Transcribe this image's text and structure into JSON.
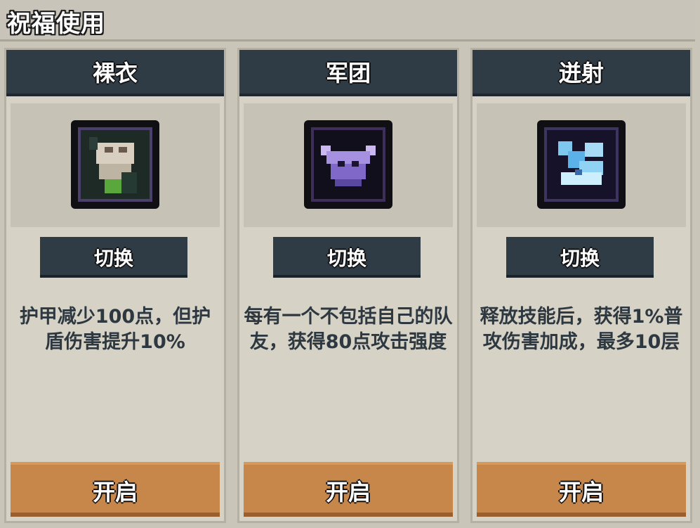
{
  "header": {
    "title": "祝福使用"
  },
  "cards": [
    {
      "title": "裸衣",
      "icon": "naked-robe-icon",
      "switch_label": "切换",
      "description": "护甲减少100点，但护盾伤害提升10%",
      "open_label": "开启"
    },
    {
      "title": "军团",
      "icon": "legion-helmet-icon",
      "switch_label": "切换",
      "description": "每有一个不包括自己的队友，获得80点攻击强度",
      "open_label": "开启"
    },
    {
      "title": "迸射",
      "icon": "burst-shard-icon",
      "switch_label": "切换",
      "description": "释放技能后，获得1%普攻伤害加成，最多10层",
      "open_label": "开启"
    }
  ],
  "colors": {
    "header_dark": "#2f3b45",
    "button_orange": "#c7864a",
    "card_bg": "#d6d2c6",
    "text_dark": "#2e3840"
  }
}
